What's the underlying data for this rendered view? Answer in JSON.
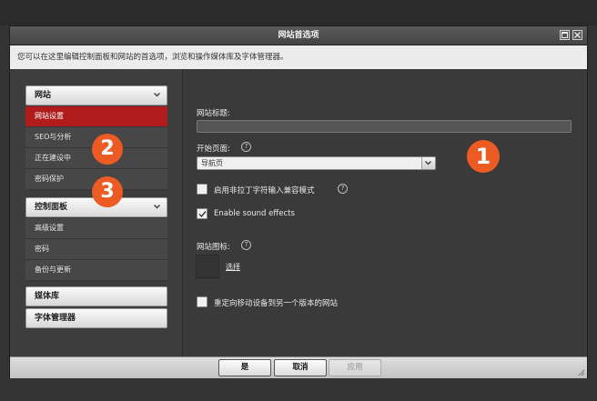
{
  "dialog": {
    "title": "网站首选项",
    "info": "您可以在这里编辑控制面板和网站的首选项，浏览和操作媒体库及字体管理器。"
  },
  "sidebar": {
    "section_website": "网站",
    "items_website": [
      "网站设置",
      "SEO与分析",
      "正在建设中",
      "密码保护"
    ],
    "section_control": "控制面板",
    "items_control": [
      "高级设置",
      "密码",
      "备份与更新"
    ],
    "section_media": "媒体库",
    "section_fonts": "字体管理器"
  },
  "content": {
    "site_title_label": "网站标题:",
    "site_title_value": "",
    "start_page_label": "开始页面:",
    "start_page_value": "导航页",
    "non_latin_label": "启用非拉丁字符输入兼容模式",
    "non_latin_checked": false,
    "sound_label": "Enable sound effects",
    "sound_checked": true,
    "site_icon_label": "网站图标:",
    "choose_label": "选择",
    "redirect_label": "重定向移动设备到另一个版本的网站",
    "redirect_checked": false,
    "help_glyph": "?"
  },
  "badges": [
    "1",
    "2",
    "3"
  ],
  "footer": {
    "ok": "是",
    "cancel": "取消",
    "apply": "应用"
  },
  "colors": {
    "accent_active": "#b01b1b",
    "badge": "#ec5b24"
  }
}
